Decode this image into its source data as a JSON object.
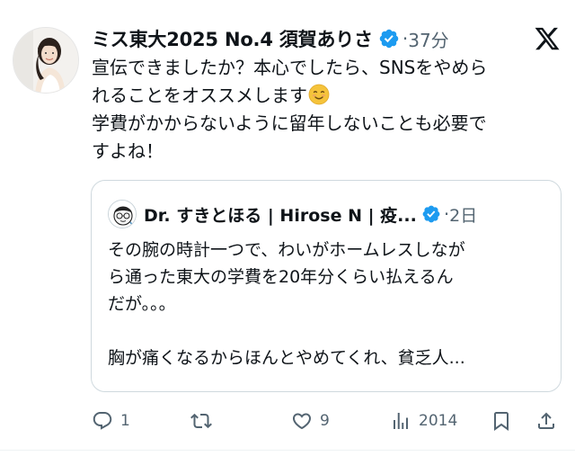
{
  "tweet": {
    "author_name": "ミス東大2025 No.4 須賀ありさ",
    "time": "37分",
    "separator": "·",
    "text_lines": [
      "宣伝できましたか？本心でしたら、SNSをやめら",
      "れることをオススメします",
      "学費がかからないように留年しないことも必要で",
      "すよね！"
    ],
    "emoji": "smiling-face-emoji"
  },
  "quote": {
    "author_name": "Dr. すきとほる | Hirose N | 疫...",
    "time": "2日",
    "separator": "·",
    "text_lines": [
      "その腕の時計一つで、わいがホームレスしなが",
      "ら通った東大の学費を20年分くらい払えるん",
      "だが。。。",
      "",
      "胸が痛くなるからほんとやめてくれ、貧乏人..."
    ]
  },
  "actions": {
    "replies": "1",
    "reposts": "",
    "likes": "9",
    "views": "2014"
  },
  "colors": {
    "verified": "#1d9bf0",
    "muted": "#536471",
    "text": "#0f1419",
    "border": "#cfd9de"
  }
}
